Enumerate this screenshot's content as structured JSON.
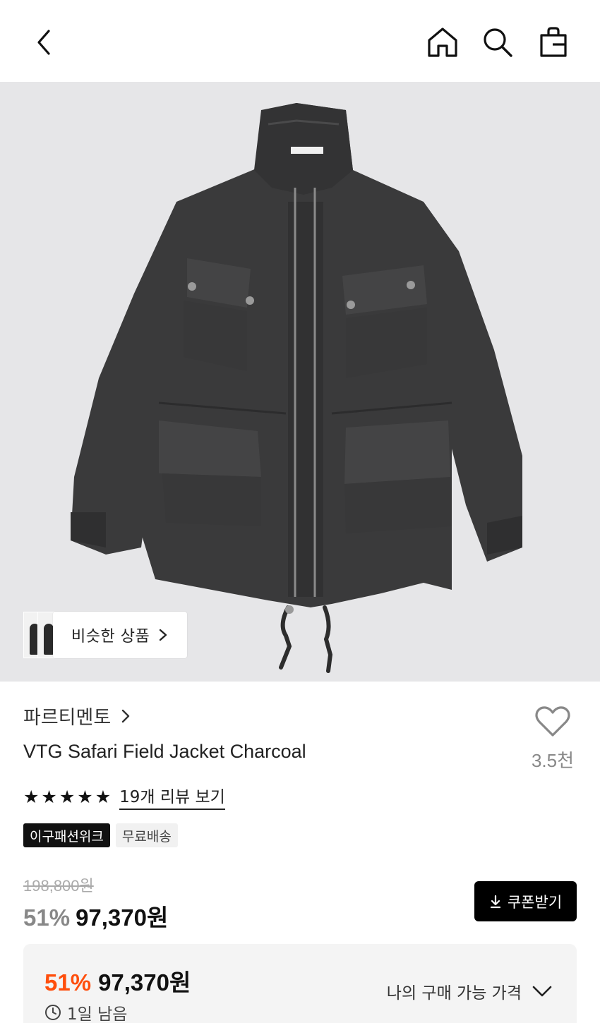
{
  "header": {
    "back_icon": "chevron-left-icon",
    "home_icon": "home-icon",
    "search_icon": "search-icon",
    "bag_icon": "shopping-bag-icon"
  },
  "hero": {
    "similar_label": "비슷한 상품"
  },
  "product": {
    "brand": "파르티멘토",
    "title": "VTG Safari Field Jacket Charcoal",
    "like_count": "3.5천",
    "rating": 5,
    "review_link": "19개 리뷰 보기",
    "badges": [
      "이구패션위크",
      "무료배송"
    ],
    "original_price": "198,800원",
    "discount_percent": "51%",
    "sale_price": "97,370원",
    "coupon_label": "쿠폰받기"
  },
  "price_box": {
    "discount_percent": "51%",
    "price": "97,370원",
    "time_left": "1일 남음",
    "my_price_label": "나의 구매 가능 가격"
  },
  "colors": {
    "accent_orange": "#ff4e0c",
    "black": "#000000",
    "hero_bg": "#e6e6e8",
    "jacket": "#3a3a3b"
  }
}
